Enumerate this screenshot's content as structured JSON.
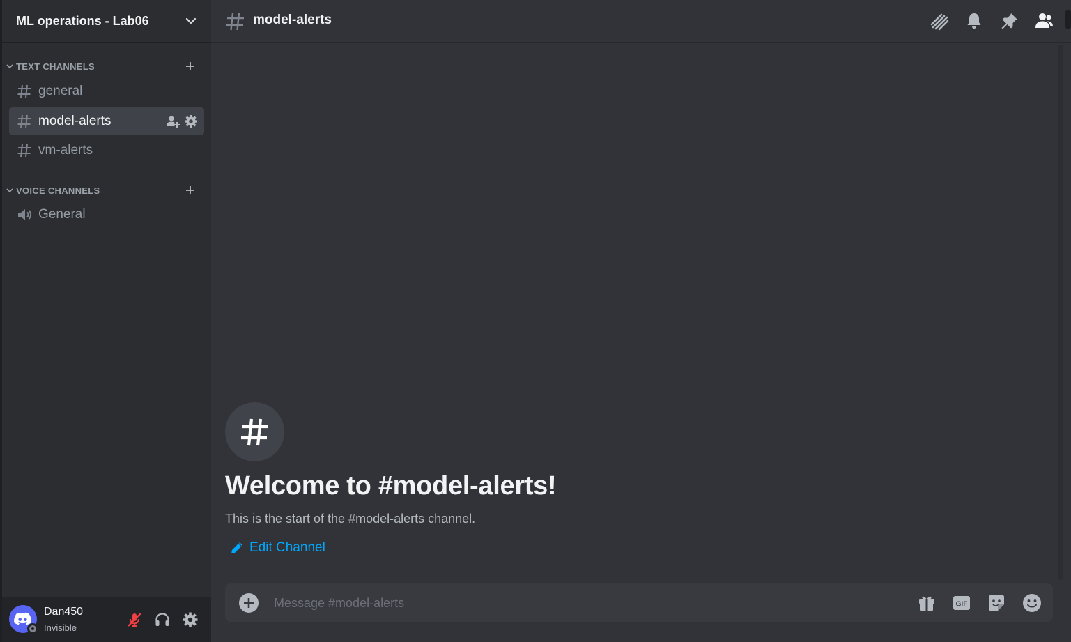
{
  "server": {
    "name": "ML operations - Lab06"
  },
  "categories": {
    "text": {
      "label": "TEXT CHANNELS"
    },
    "voice": {
      "label": "VOICE CHANNELS"
    }
  },
  "text_channels": [
    {
      "label": "general",
      "active": false
    },
    {
      "label": "model-alerts",
      "active": true
    },
    {
      "label": "vm-alerts",
      "active": false
    }
  ],
  "voice_channels": [
    {
      "label": "General"
    }
  ],
  "user": {
    "name": "Dan450",
    "status": "Invisible"
  },
  "header": {
    "channel_name": "model-alerts",
    "icons": [
      "threads-icon",
      "notification-bell-icon",
      "pin-icon",
      "member-list-icon"
    ]
  },
  "welcome": {
    "title": "Welcome to #model-alerts!",
    "subtitle": "This is the start of the #model-alerts channel.",
    "edit_label": "Edit Channel"
  },
  "composer": {
    "placeholder": "Message #model-alerts",
    "icons": [
      "gift-icon",
      "gif-icon",
      "sticker-icon",
      "emoji-icon"
    ]
  },
  "colors": {
    "accent_link": "#00a8fc",
    "brand": "#5865f2",
    "muted_mic": "#f23f43",
    "status_invisible": "#80848e"
  }
}
